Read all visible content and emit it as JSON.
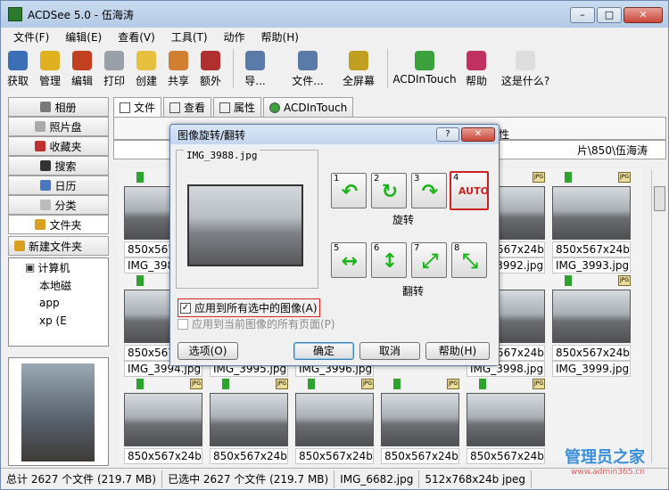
{
  "window": {
    "title": "ACDSee 5.0 - 伍海涛"
  },
  "menu": [
    "文件(F)",
    "编辑(E)",
    "查看(V)",
    "工具(T)",
    "动作",
    "帮助(H)"
  ],
  "toolbar": [
    {
      "label": "获取",
      "icon": "acquire-icon"
    },
    {
      "label": "管理",
      "icon": "manage-icon"
    },
    {
      "label": "编辑",
      "icon": "edit-icon"
    },
    {
      "label": "打印",
      "icon": "print-icon"
    },
    {
      "label": "创建",
      "icon": "create-icon"
    },
    {
      "label": "共享",
      "icon": "share-icon"
    },
    {
      "label": "额外",
      "icon": "extra-icon"
    },
    {
      "label": "导...",
      "icon": "nav-icon"
    },
    {
      "label": "文件...",
      "icon": "file-icon"
    },
    {
      "label": "全屏幕",
      "icon": "fullscreen-icon"
    },
    {
      "label": "ACDInTouch",
      "icon": "acdintouch-icon"
    },
    {
      "label": "帮助",
      "icon": "help-book-icon"
    },
    {
      "label": "这是什么?",
      "icon": "whats-this-icon"
    }
  ],
  "left_nav": [
    "相册",
    "照片盘",
    "收藏夹",
    "搜索",
    "日历",
    "分类",
    "文件夹"
  ],
  "left_extra": {
    "new_folder": "新建文件夹"
  },
  "tree": [
    "计算机",
    "本地磁",
    "app",
    "xp (E"
  ],
  "tabs": [
    "文件",
    "查看",
    "属性",
    "ACDInTouch"
  ],
  "subbar_partial": "性",
  "path": "片\\850\\伍海涛",
  "thumbnails": [
    {
      "size": "850x567x24b",
      "name": "IMG_3988.jpg"
    },
    {
      "size": "850x567x24b",
      "name": "IMG_3992.jpg"
    },
    {
      "size": "850x567x24b",
      "name": "IMG_3993.jpg"
    },
    {
      "size": "850x567x24b",
      "name": "IMG_3994.jpg"
    },
    {
      "size": "850x567x24b",
      "name": "IMG_3995.jpg"
    },
    {
      "size": "850x567x24b",
      "name": "IMG_3996.jpg"
    },
    {
      "size": "850x567x24b",
      "name": "IMG_3998.jpg"
    },
    {
      "size": "850x567x24b",
      "name": "IMG_3999.jpg"
    },
    {
      "size": "850x567x24b",
      "name": ""
    },
    {
      "size": "850x567x24b",
      "name": ""
    },
    {
      "size": "850x567x24b",
      "name": ""
    },
    {
      "size": "850x567x24b",
      "name": ""
    },
    {
      "size": "850x567x24b",
      "name": ""
    }
  ],
  "dialog": {
    "title": "图像旋转/翻转",
    "filename": "IMG_3988.jpg",
    "rotate_label": "旋转",
    "flip_label": "翻转",
    "apply_all": "应用到所有选中的图像(A)",
    "apply_pages": "应用到当前图像的所有页面(P)",
    "btn_options": "选项(O)",
    "btn_ok": "确定",
    "btn_cancel": "取消",
    "btn_help": "帮助(H)",
    "help_glyph": "?",
    "close_glyph": "✕",
    "buttons": [
      "1",
      "2",
      "3",
      "4",
      "5",
      "6",
      "7",
      "8"
    ],
    "auto_label": "AUTO"
  },
  "status": {
    "total": "总计 2627 个文件 (219.7 MB)",
    "selected": "已选中 2627 个文件 (219.7 MB)",
    "current": "IMG_6682.jpg",
    "info": "512x768x24b jpeg"
  },
  "watermark": {
    "main": "管理员之家",
    "sub": "www.admin365.cn"
  }
}
